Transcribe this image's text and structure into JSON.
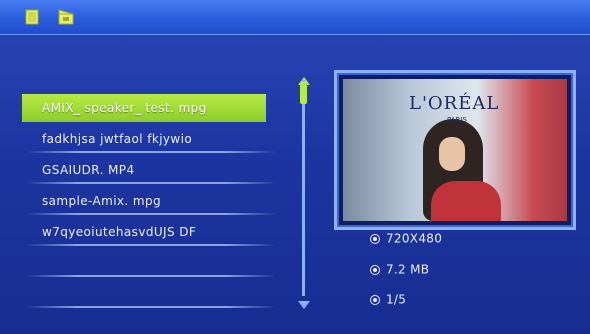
{
  "top_bar": {
    "icons": [
      "folder-icon",
      "video-icon"
    ]
  },
  "file_list": {
    "items": [
      {
        "name": "AMIX_ speaker_ test. mpg",
        "selected": true
      },
      {
        "name": "fadkhjsa jwtfaol fkjywio",
        "selected": false
      },
      {
        "name": "GSAIUDR. MP4",
        "selected": false
      },
      {
        "name": "sample-Amix. mpg",
        "selected": false
      },
      {
        "name": "w7qyeoiutehasvdUJS DF",
        "selected": false
      }
    ]
  },
  "preview": {
    "brand": "L'ORÉAL",
    "brand_sub": "PARIS"
  },
  "info": {
    "resolution": "720X480",
    "size": "7.2 MB",
    "page": "1/5"
  },
  "scroll": {
    "position_fraction": 0.0
  },
  "colors": {
    "highlight": "#8ccc2a",
    "background": "#1d35a2",
    "topbar": "#2d5ee0"
  }
}
